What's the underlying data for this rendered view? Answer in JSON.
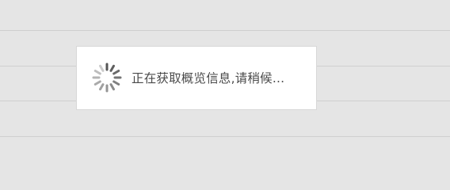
{
  "loading_dialog": {
    "message": "正在获取概览信息,请稍候...",
    "spinner_icon": "loading-spinner-icon"
  },
  "colors": {
    "background": "#e5e5e5",
    "divider": "#cfcfcf",
    "dialog_background": "#ffffff",
    "text": "#4a4a4a",
    "spinner": "#555555"
  }
}
